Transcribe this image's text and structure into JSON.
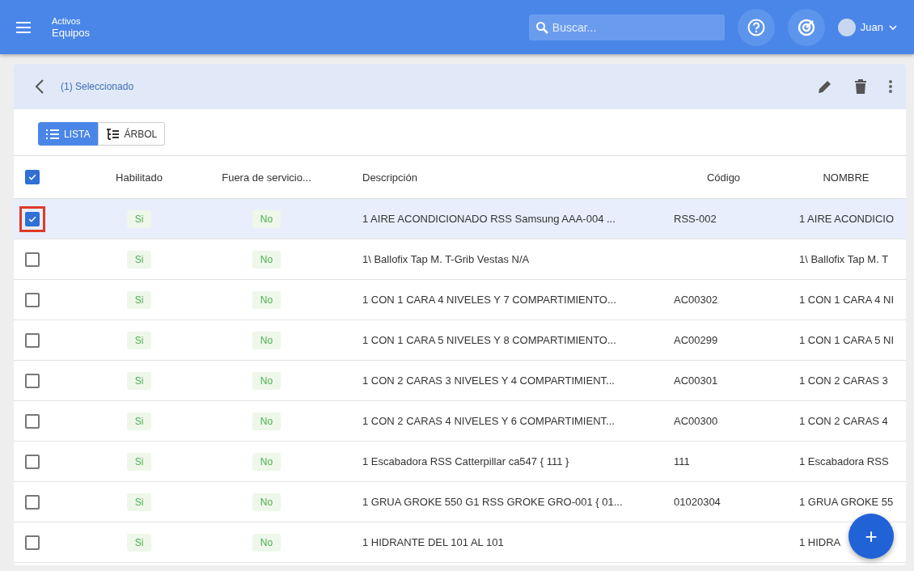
{
  "topbar": {
    "breadcrumb_parent": "Activos",
    "title": "Equipos",
    "search": {
      "placeholder": "Buscar..."
    },
    "user": "Juan"
  },
  "selection_bar": {
    "label": "(1) Seleccionado"
  },
  "view_toggle": [
    {
      "label": "LISTA",
      "selected": true
    },
    {
      "label": "ÁRBOL",
      "selected": false
    }
  ],
  "table": {
    "header_checked": true,
    "columns": [
      "Habilitado",
      "Fuera de servicio...",
      "Descripción",
      "Código",
      "NOMBRE"
    ],
    "rows": [
      {
        "selected": true,
        "highlighted": true,
        "enabled": "Si",
        "out_of_service": "No",
        "description": "1 AIRE ACONDICIONADO RSS Samsung AAA-004 ...",
        "code": "RSS-002",
        "name": "1 AIRE ACONDICIO"
      },
      {
        "selected": false,
        "highlighted": false,
        "enabled": "Si",
        "out_of_service": "No",
        "description": "1\\ Ballofix Tap M. T-Grib Vestas N/A",
        "code": "",
        "name": "1\\ Ballofix Tap M. T"
      },
      {
        "selected": false,
        "highlighted": false,
        "enabled": "Si",
        "out_of_service": "No",
        "description": "1 CON 1 CARA 4 NIVELES Y 7 COMPARTIMIENTO...",
        "code": "AC00302",
        "name": "1 CON 1 CARA 4 NI"
      },
      {
        "selected": false,
        "highlighted": false,
        "enabled": "Si",
        "out_of_service": "No",
        "description": "1 CON 1 CARA 5 NIVELES Y 8 COMPARTIMIENTO...",
        "code": "AC00299",
        "name": "1 CON 1 CARA 5 NI"
      },
      {
        "selected": false,
        "highlighted": false,
        "enabled": "Si",
        "out_of_service": "No",
        "description": "1 CON 2 CARAS 3 NIVELES Y 4 COMPARTIMIENT...",
        "code": "AC00301",
        "name": "1 CON 2 CARAS 3"
      },
      {
        "selected": false,
        "highlighted": false,
        "enabled": "Si",
        "out_of_service": "No",
        "description": "1 CON 2 CARAS 4 NIVELES Y 6 COMPARTIMIENT...",
        "code": "AC00300",
        "name": "1 CON 2 CARAS 4"
      },
      {
        "selected": false,
        "highlighted": false,
        "enabled": "Si",
        "out_of_service": "No",
        "description": "1 Escabadora RSS Catterpillar ca547 { 111 }",
        "code": "111",
        "name": "1 Escabadora RSS"
      },
      {
        "selected": false,
        "highlighted": false,
        "enabled": "Si",
        "out_of_service": "No",
        "description": "1 GRUA GROKE 550 G1 RSS GROKE GRO-001 { 01...",
        "code": "01020304",
        "name": "1 GRUA GROKE 55"
      },
      {
        "selected": false,
        "highlighted": false,
        "enabled": "Si",
        "out_of_service": "No",
        "description": "1 HIDRANTE DEL 101 AL 101",
        "code": "",
        "name": "1 HIDRA"
      }
    ]
  },
  "fab": {
    "label": "+"
  }
}
